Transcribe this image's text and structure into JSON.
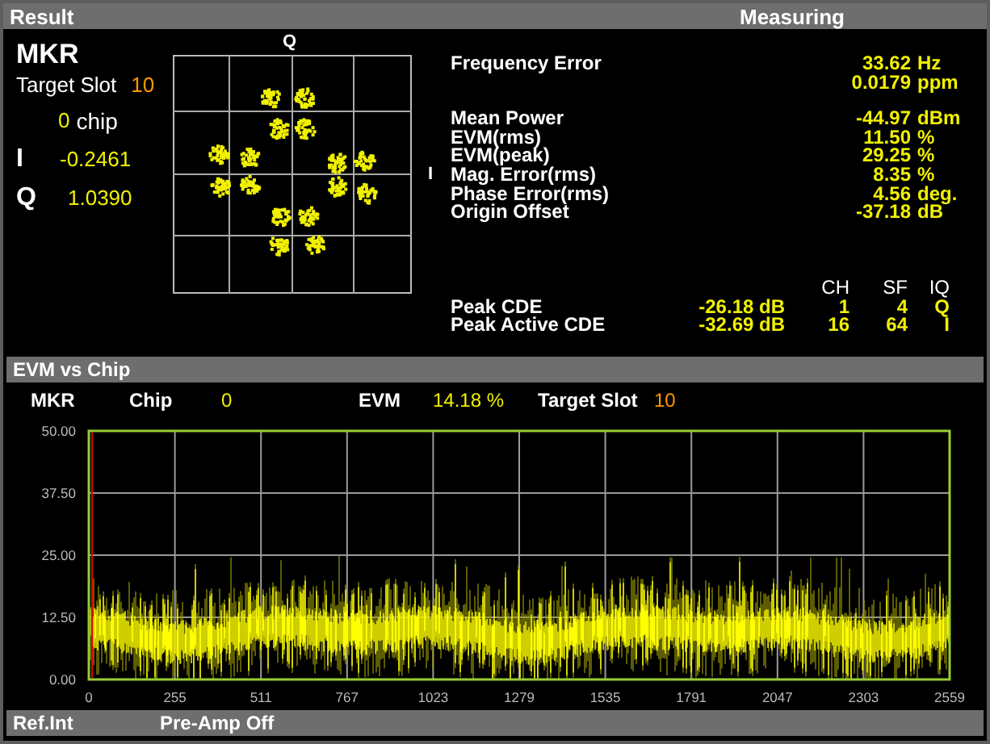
{
  "result_bar": {
    "title": "Result",
    "status": "Measuring"
  },
  "marker": {
    "title": "MKR",
    "target_slot_label": "Target Slot",
    "target_slot": "10",
    "chip": "0",
    "chip_unit": "chip",
    "i_label": "I",
    "i_value": "-0.2461",
    "q_label": "Q",
    "q_value": "1.0390"
  },
  "constellation": {
    "q_axis": "Q",
    "i_axis": "I"
  },
  "measurement_groups": [
    {
      "rows": [
        {
          "label": "Frequency Error",
          "values": [
            {
              "value": "33.62",
              "unit": "Hz"
            },
            {
              "value": "0.0179",
              "unit": "ppm"
            }
          ]
        }
      ]
    },
    {
      "rows": [
        {
          "label": "Mean Power",
          "values": [
            {
              "value": "-44.97",
              "unit": "dBm"
            }
          ]
        },
        {
          "label": "EVM(rms)",
          "values": [
            {
              "value": "11.50",
              "unit": "%"
            }
          ]
        },
        {
          "label": "EVM(peak)",
          "values": [
            {
              "value": "29.25",
              "unit": "%"
            }
          ]
        },
        {
          "label": "Mag. Error(rms)",
          "values": [
            {
              "value": "8.35",
              "unit": "%"
            }
          ]
        },
        {
          "label": "Phase Error(rms)",
          "values": [
            {
              "value": "4.56",
              "unit": "deg."
            }
          ]
        },
        {
          "label": "Origin Offset",
          "values": [
            {
              "value": "-37.18",
              "unit": "dB"
            }
          ]
        }
      ]
    }
  ],
  "cde": {
    "columns": [
      "CH",
      "SF",
      "IQ"
    ],
    "rows": [
      {
        "label": "Peak CDE",
        "value": "-26.18 dB",
        "ch": "1",
        "sf": "4",
        "iq": "Q"
      },
      {
        "label": "Peak Active CDE",
        "value": "-32.69 dB",
        "ch": "16",
        "sf": "64",
        "iq": "I"
      }
    ]
  },
  "evm_bar": {
    "title": "EVM vs Chip"
  },
  "evm_marker": {
    "mkr": "MKR",
    "chip_label": "Chip",
    "chip": "0",
    "evm_label": "EVM",
    "evm": "14.18 %",
    "slot_label": "Target Slot",
    "slot": "10"
  },
  "evm_chart": {
    "y_ticks": [
      "50.00",
      "37.50",
      "25.00",
      "12.50",
      "0.00"
    ],
    "x_ticks": [
      "0",
      "255",
      "511",
      "767",
      "1023",
      "1279",
      "1535",
      "1791",
      "2047",
      "2303",
      "2559"
    ]
  },
  "status_bar": [
    "Ref.Int",
    "Pre-Amp Off"
  ]
}
